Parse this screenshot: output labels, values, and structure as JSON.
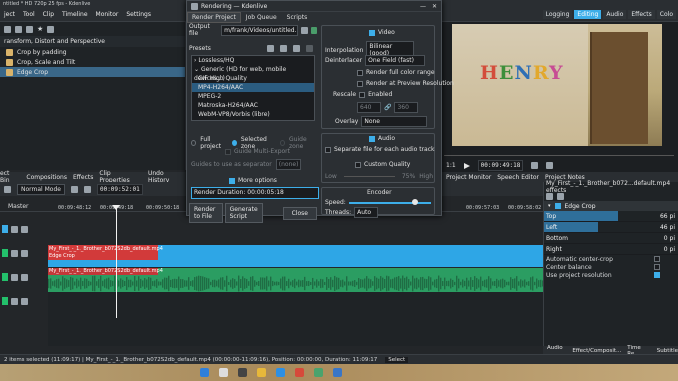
{
  "window_title": "ntitled * HD 720p 25 fps - Kdenlive",
  "menu": [
    "ject",
    "Tool",
    "Clip",
    "Timeline",
    "Monitor",
    "Settings"
  ],
  "menu_first": "Project",
  "layout_tabs": [
    "Logging",
    "Editing",
    "Audio",
    "Effects",
    "Colo"
  ],
  "effects": {
    "header": "ransform, Distort and Perspective",
    "items": [
      "Crop by padding",
      "Crop, Scale and Tilt",
      "Edge Crop"
    ]
  },
  "left_tabs": [
    "ect Bin",
    "Compositions",
    "Effects",
    "Clip Properties",
    "Undo History"
  ],
  "monitor": {
    "zoom": "1:1",
    "in_out": "In Point",
    "timecode": "00:09:49:18",
    "scale": "1:1",
    "video_text": "HENRY"
  },
  "monitor_tabs": [
    "Project Monitor",
    "Speech Editor",
    "Project Notes"
  ],
  "stack": {
    "title": "My_First_-_1._Brother_b072...default.mp4 effects",
    "effect": "Edge Crop",
    "params": [
      {
        "label": "Top",
        "value": "66 pi",
        "fill": 0.55
      },
      {
        "label": "Left",
        "value": "46 pi",
        "fill": 0.4
      },
      {
        "label": "Bottom",
        "value": "0 pi",
        "fill": 0.0
      },
      {
        "label": "Right",
        "value": "0 pi",
        "fill": 0.0
      }
    ],
    "checks": [
      {
        "label": "Automatic center-crop",
        "on": false
      },
      {
        "label": "Center balance",
        "on": false
      },
      {
        "label": "Use project resolution",
        "on": true
      }
    ],
    "tabs": [
      "Audio ...",
      "Effect/Composit...",
      "Time Re...",
      "Subtitle"
    ]
  },
  "timeline": {
    "mode": "Normal Mode",
    "timecode": "00:09:52:01",
    "master": "Master",
    "ticks": [
      "00:09:48:12",
      "00:09:49:18",
      "00:09:50:18",
      "00:09:57:03",
      "00:09:58:02"
    ],
    "video_clip": "My_First_-_1._Brother_b072S2db_default.mp4",
    "video_fx": "Edge Crop",
    "audio_clip": "My_First_-_1._Brother_b072S2db_default.mp4"
  },
  "status": {
    "text": "2 items selected (11:09:17) | My_First_-_1._Brother_b072S2db_default.mp4 (00:00:00-11:09:16), Position: 00:00:00, Duration: 11:09:17",
    "mode": "Select"
  },
  "render": {
    "title": "Rendering — Kdenlive",
    "tabs": [
      "Render Project",
      "Job Queue",
      "Scripts"
    ],
    "output_label": "Output file",
    "output_value": "m/frank/Videos/untitled.mp4",
    "presets_label": "Presets",
    "presets": [
      {
        "label": "Lossless/HQ",
        "group": true,
        "active": false
      },
      {
        "label": "Generic (HD for web, mobile devices...)",
        "group": true,
        "active": false
      },
      {
        "label": "GIF High Quality",
        "group": false,
        "active": false
      },
      {
        "label": "MP4-H264/AAC",
        "group": false,
        "active": true
      },
      {
        "label": "MPEG-2",
        "group": false,
        "active": false
      },
      {
        "label": "Matroska-H264/AAC",
        "group": false,
        "active": false
      },
      {
        "label": "WebM-VP8/Vorbis (libre)",
        "group": false,
        "active": false
      }
    ],
    "range": {
      "full": "Full project",
      "zone": "Selected zone",
      "guide": "Guide zone"
    },
    "multi_export": "Guide Multi-Export",
    "guide_separator": "Guides to use as separator",
    "guide_select": "(none)",
    "more_options": "More options",
    "duration": "Render Duration: 00:00:05:18",
    "buttons": {
      "render_file": "Render to File",
      "gen_script": "Generate Script",
      "close": "Close"
    },
    "video": {
      "label": "Video",
      "interpolation_label": "Interpolation",
      "interpolation": "Bilinear (good)",
      "deinterlacer_label": "Deinterlacer",
      "deinterlacer": "One Field (fast)",
      "full_color": "Render full color range",
      "preview_res": "Render at Preview Resolution",
      "rescale": "Rescale",
      "enabled": "Enabled",
      "w": "640",
      "h": "360",
      "overlay_label": "Overlay",
      "overlay": "None"
    },
    "audio": {
      "label": "Audio",
      "separate": "Separate file for each audio track",
      "custom_quality": "Custom Quality",
      "low": "Low",
      "pct": "75%",
      "hq": "High"
    },
    "encoder": {
      "label": "Encoder",
      "speed_label": "Speed:",
      "speed": 0.8,
      "threads_label": "Threads:",
      "threads": "Auto"
    }
  }
}
